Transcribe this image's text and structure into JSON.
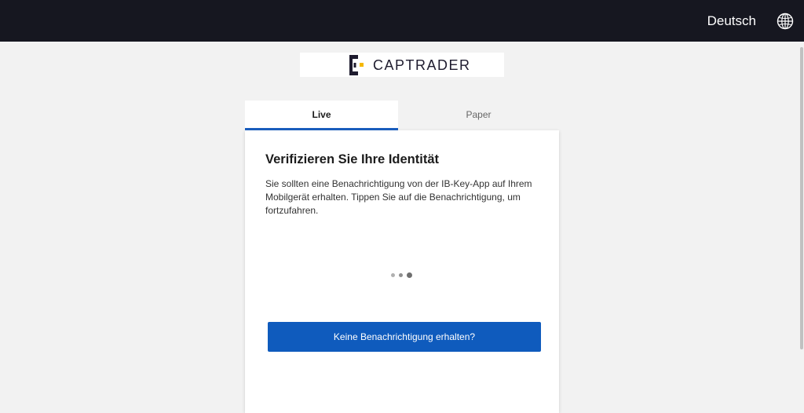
{
  "header": {
    "language_label": "Deutsch",
    "language_icon": "globe-icon",
    "background_color": "#161720"
  },
  "brand": {
    "name": "CAPTRADER",
    "accent_color": "#f5b800"
  },
  "tabs": [
    {
      "label": "Live",
      "active": true
    },
    {
      "label": "Paper",
      "active": false
    }
  ],
  "card": {
    "title": "Verifizieren Sie Ihre Identität",
    "message": "Sie sollten eine Benachrichtigung von der IB-Key-App auf Ihrem Mobilgerät erhalten. Tippen Sie auf die Benachrichtigung, um fortzufahren.",
    "loading_indicator": "three-dot-loader",
    "button_label": "Keine Benachrichtigung erhalten?",
    "button_color": "#0f5bbd"
  }
}
